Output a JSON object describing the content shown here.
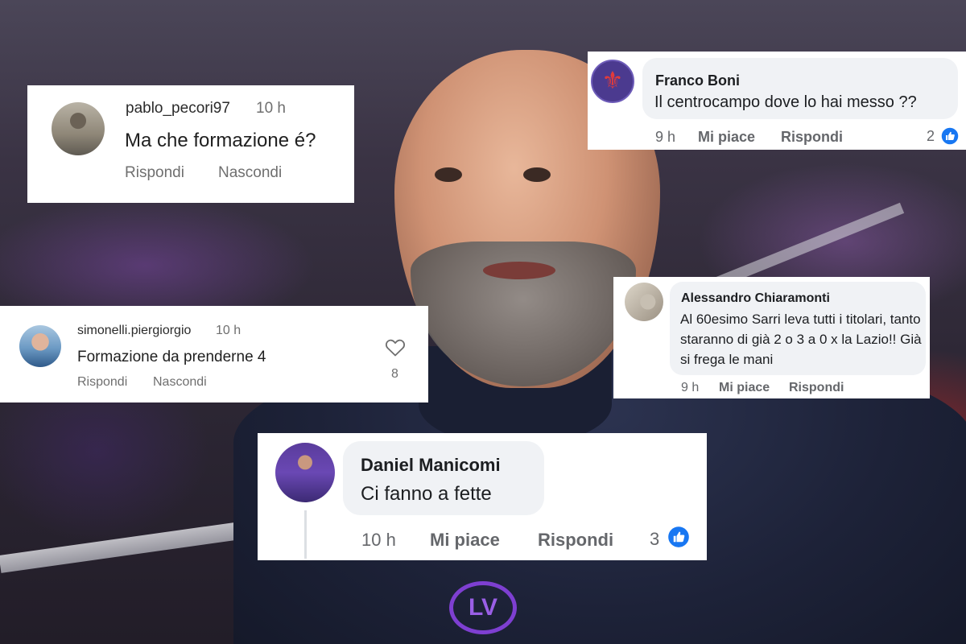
{
  "crest_text": "LV",
  "comments": {
    "pablo": {
      "username": "pablo_pecori97",
      "time": "10 h",
      "text": "Ma che formazione é?",
      "actions": [
        "Rispondi",
        "Nascondi"
      ]
    },
    "franco": {
      "username": "Franco Boni",
      "text": "Il centrocampo dove lo hai messo ??",
      "time": "9 h",
      "like_label": "Mi piace",
      "reply_label": "Rispondi",
      "reaction_count": "2"
    },
    "alessandro": {
      "username": "Alessandro Chiaramonti",
      "text": "Al 60esimo Sarri leva tutti i titolari, tanto staranno di già 2 o 3 a 0 x la Lazio!! Già si frega le mani",
      "time": "9 h",
      "like_label": "Mi piace",
      "reply_label": "Rispondi"
    },
    "simonelli": {
      "username": "simonelli.piergiorgio",
      "time": "10 h",
      "text": "Formazione da prenderne 4",
      "actions": [
        "Rispondi",
        "Nascondi"
      ],
      "heart_count": "8"
    },
    "daniel": {
      "username": "Daniel Manicomi",
      "text": "Ci fanno a fette",
      "time": "10 h",
      "like_label": "Mi piace",
      "reply_label": "Rispondi",
      "reaction_count": "3"
    }
  },
  "icons": {
    "facebook_like": "thumbs-up-icon",
    "instagram_heart": "heart-icon"
  },
  "colors": {
    "facebook_blue": "#1877f2",
    "fiorentina_purple": "#7e3fd1",
    "bubble_gray": "#f0f2f5"
  }
}
